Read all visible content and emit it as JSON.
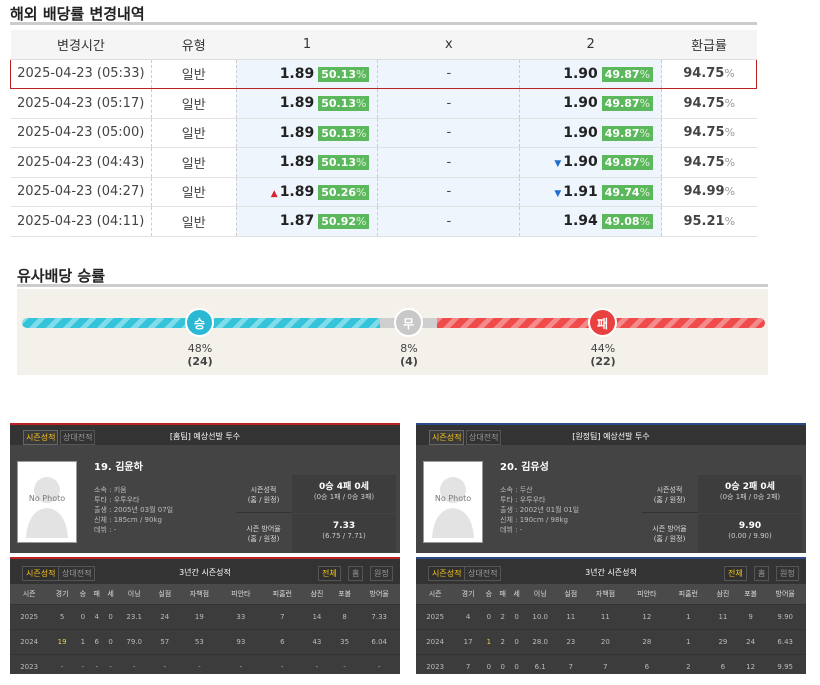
{
  "odds_section": {
    "title": "해외 배당률 변경내역",
    "headers": [
      "변경시간",
      "유형",
      "1",
      "x",
      "2",
      "환급률"
    ],
    "rows": [
      {
        "time": "2025-04-23 (05:33)",
        "type": "일반",
        "o1": "1.89",
        "p1": "50.13",
        "x": "-",
        "o2": "1.90",
        "p2": "49.87",
        "ret": "94.75",
        "a1": "",
        "a2": ""
      },
      {
        "time": "2025-04-23 (05:17)",
        "type": "일반",
        "o1": "1.89",
        "p1": "50.13",
        "x": "-",
        "o2": "1.90",
        "p2": "49.87",
        "ret": "94.75",
        "a1": "",
        "a2": ""
      },
      {
        "time": "2025-04-23 (05:00)",
        "type": "일반",
        "o1": "1.89",
        "p1": "50.13",
        "x": "-",
        "o2": "1.90",
        "p2": "49.87",
        "ret": "94.75",
        "a1": "",
        "a2": ""
      },
      {
        "time": "2025-04-23 (04:43)",
        "type": "일반",
        "o1": "1.89",
        "p1": "50.13",
        "x": "-",
        "o2": "1.90",
        "p2": "49.87",
        "ret": "94.75",
        "a1": "",
        "a2": "down"
      },
      {
        "time": "2025-04-23 (04:27)",
        "type": "일반",
        "o1": "1.89",
        "p1": "50.26",
        "x": "-",
        "o2": "1.91",
        "p2": "49.74",
        "ret": "94.99",
        "a1": "up",
        "a2": "down"
      },
      {
        "time": "2025-04-23 (04:11)",
        "type": "일반",
        "o1": "1.87",
        "p1": "50.92",
        "x": "-",
        "o2": "1.94",
        "p2": "49.08",
        "ret": "95.21",
        "a1": "",
        "a2": ""
      }
    ],
    "pct_symbol": "%"
  },
  "similar_section": {
    "title": "유사배당 승률",
    "win": {
      "label": "승",
      "pct": "48%",
      "count": "(24)",
      "value": 48
    },
    "draw": {
      "label": "무",
      "pct": "8%",
      "count": "(4)",
      "value": 8
    },
    "loss": {
      "label": "패",
      "pct": "44%",
      "count": "(22)",
      "value": 44
    }
  },
  "pitchers": [
    {
      "tab_season": "시즌성적",
      "tab_opp": "상대전적",
      "header": "[홈팀] 예상선발 투수",
      "photo_text": "No Photo",
      "name": "19. 김윤하",
      "info": [
        "소속 : 키움",
        "투타 : 우투우타",
        "출생 : 2005년 03월 07일",
        "신체 : 185cm / 90kg",
        "데뷔 : -"
      ],
      "season_label": "시즌성적",
      "season_sub": "(홈 / 원정)",
      "season_value": "0승 4패 0세",
      "season_detail": "(0승 1패 / 0승 3패)",
      "era_label": "시즌 방어율",
      "era_sub": "(홈 / 원정)",
      "era_value": "7.33",
      "era_detail": "(6.75 / 7.71)"
    },
    {
      "tab_season": "시즌성적",
      "tab_opp": "상대전적",
      "header": "[원정팀] 예상선발 투수",
      "photo_text": "No Photo",
      "name": "20. 김유성",
      "info": [
        "소속 : 두산",
        "투타 : 우투우타",
        "출생 : 2002년 01월 01일",
        "신체 : 190cm / 98kg",
        "데뷔 : -"
      ],
      "season_label": "시즌성적",
      "season_sub": "(홈 / 원정)",
      "season_value": "0승 2패 0세",
      "season_detail": "(0승 1패 / 0승 2패)",
      "era_label": "시즌 방어율",
      "era_sub": "(홈 / 원정)",
      "era_value": "9.90",
      "era_detail": "(0.00 / 9.90)"
    }
  ],
  "stats": [
    {
      "tab_season": "시즌성적",
      "tab_opp": "상대전적",
      "title": "3년간 시즌성적",
      "filters": [
        "전체",
        "홈",
        "원정"
      ],
      "headers": [
        "시즌",
        "경기",
        "승",
        "패",
        "세",
        "이닝",
        "실점",
        "자책점",
        "피안타",
        "피홈런",
        "삼진",
        "포볼",
        "방어율"
      ],
      "rows": [
        [
          "2025",
          "5",
          "0",
          "4",
          "0",
          "23.1",
          "24",
          "19",
          "33",
          "7",
          "14",
          "8",
          "7.33"
        ],
        [
          "2024",
          "19",
          "1",
          "6",
          "0",
          "79.0",
          "57",
          "53",
          "93",
          "6",
          "43",
          "35",
          "6.04"
        ],
        [
          "2023",
          "-",
          "-",
          "-",
          "-",
          "-",
          "-",
          "-",
          "-",
          "-",
          "-",
          "-",
          "-"
        ]
      ]
    },
    {
      "tab_season": "시즌성적",
      "tab_opp": "상대전적",
      "title": "3년간 시즌성적",
      "filters": [
        "전체",
        "홈",
        "원정"
      ],
      "headers": [
        "시즌",
        "경기",
        "승",
        "패",
        "세",
        "이닝",
        "실점",
        "자책점",
        "피안타",
        "피홈런",
        "삼진",
        "포볼",
        "방어율"
      ],
      "rows": [
        [
          "2025",
          "4",
          "0",
          "2",
          "0",
          "10.0",
          "11",
          "11",
          "12",
          "1",
          "11",
          "9",
          "9.90"
        ],
        [
          "2024",
          "17",
          "1",
          "2",
          "0",
          "28.0",
          "23",
          "20",
          "28",
          "1",
          "29",
          "24",
          "6.43"
        ],
        [
          "2023",
          "7",
          "0",
          "0",
          "0",
          "6.1",
          "7",
          "7",
          "6",
          "2",
          "6",
          "12",
          "9.95"
        ]
      ]
    }
  ]
}
